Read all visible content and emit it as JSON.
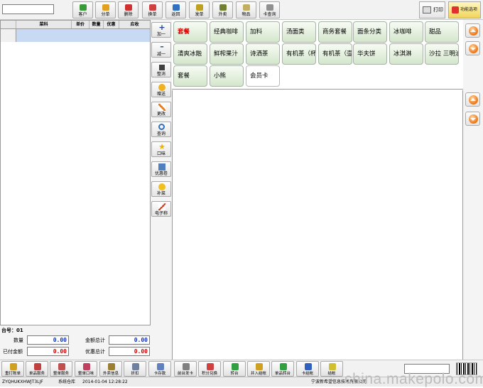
{
  "toolbar": {
    "search_value": "",
    "buttons": [
      {
        "label": "客户",
        "icon": "customer-icon",
        "color": "#3a9a3a"
      },
      {
        "label": "分单",
        "icon": "split-bill-icon",
        "color": "#e0a020"
      },
      {
        "label": "删除",
        "icon": "delete-icon",
        "color": "#d03030"
      },
      {
        "label": "换单",
        "icon": "swap-bill-icon",
        "color": "#d04040"
      },
      {
        "label": "返回",
        "icon": "return-icon",
        "color": "#3070c0"
      },
      {
        "label": "发单",
        "icon": "send-order-icon",
        "color": "#c0a020"
      },
      {
        "label": "外卖",
        "icon": "takeaway-icon",
        "color": "#708030"
      },
      {
        "label": "物品",
        "icon": "goods-icon",
        "color": "#c0b060"
      },
      {
        "label": "卡查询",
        "icon": "card-query-icon",
        "color": "#909090"
      }
    ],
    "print_label": "打印",
    "function_label": "功能选项"
  },
  "order_grid": {
    "columns": [
      "菜科",
      "单价",
      "数量",
      "优惠",
      "应收"
    ]
  },
  "side_actions": [
    {
      "label": "加一",
      "icon": "plus-icon"
    },
    {
      "label": "减一",
      "icon": "minus-icon"
    },
    {
      "label": "整消",
      "icon": "cancel-all-icon"
    },
    {
      "label": "赠送",
      "icon": "gift-icon"
    },
    {
      "label": "更改",
      "icon": "edit-icon"
    },
    {
      "label": "查询",
      "icon": "search-icon"
    },
    {
      "label": "口味",
      "icon": "star-icon"
    },
    {
      "label": "优惠卷",
      "icon": "coupon-icon"
    },
    {
      "label": "补菜",
      "icon": "add-dish-icon"
    },
    {
      "label": "电子称",
      "icon": "scale-icon"
    }
  ],
  "categories": [
    {
      "label": "套餐",
      "active": true
    },
    {
      "label": "经典咖啡"
    },
    {
      "label": "加料"
    },
    {
      "label": "汤面类"
    },
    {
      "label": "商务套餐"
    },
    {
      "label": "面条分类"
    },
    {
      "label": "冰咖啡"
    },
    {
      "label": "甜品"
    },
    {
      "label": "清爽冰融"
    },
    {
      "label": "鲜榨果汁"
    },
    {
      "label": "诗洒茶"
    },
    {
      "label": "有机茶（杯"
    },
    {
      "label": "有机茶（壶"
    },
    {
      "label": "华夫饼"
    },
    {
      "label": "冰淇淋"
    },
    {
      "label": "沙拉 三明治"
    },
    {
      "label": "套餐"
    },
    {
      "label": "小熊"
    },
    {
      "label": "会员卡"
    }
  ],
  "summary": {
    "table_no": "台号：01",
    "qty_label": "数量",
    "qty_value": "0.00",
    "total_label": "金额总计",
    "total_value": "0.00",
    "paid_label": "已付金额",
    "paid_value": "0.00",
    "discount_label": "优惠总计",
    "discount_value": "0.00"
  },
  "bottom_buttons": [
    {
      "label": "重打账单",
      "icon": "reprint-icon",
      "color": "#d0a020"
    },
    {
      "label": "单品服务",
      "icon": "item-service-icon",
      "color": "#c04040"
    },
    {
      "label": "整单服务",
      "icon": "order-service-icon",
      "color": "#c05050"
    },
    {
      "label": "整单口味",
      "icon": "order-taste-icon",
      "color": "#c04060"
    },
    {
      "label": "外卖信息",
      "icon": "takeaway-info-icon",
      "color": "#9a8030"
    },
    {
      "label": "折扣",
      "icon": "discount-icon",
      "color": "#7080a0"
    },
    {
      "label": "卡存款",
      "icon": "card-deposit-icon",
      "color": "#6080c0"
    },
    {
      "label": "前台发卡",
      "icon": "issue-card-icon",
      "color": "#808080"
    },
    {
      "label": "积分兑换",
      "icon": "points-icon",
      "color": "#d04040"
    },
    {
      "label": "转台",
      "icon": "transfer-table-icon",
      "color": "#30a040"
    },
    {
      "label": "并入结帐",
      "icon": "merge-checkout-icon",
      "color": "#d0a020"
    },
    {
      "label": "单品转台",
      "icon": "item-transfer-icon",
      "color": "#30a040"
    },
    {
      "label": "卡结帐",
      "icon": "card-checkout-icon",
      "color": "#3060c0"
    },
    {
      "label": "结帐",
      "icon": "checkout-icon",
      "color": "#d0c030"
    }
  ],
  "status": {
    "user": "ZYQHUKXHWJT3LJF",
    "store": "系统仓库",
    "datetime": "2014-01-04 12:28:22",
    "company": "宁波新希望信息技术有限公司",
    "watermark": "china.makepolo.com"
  }
}
